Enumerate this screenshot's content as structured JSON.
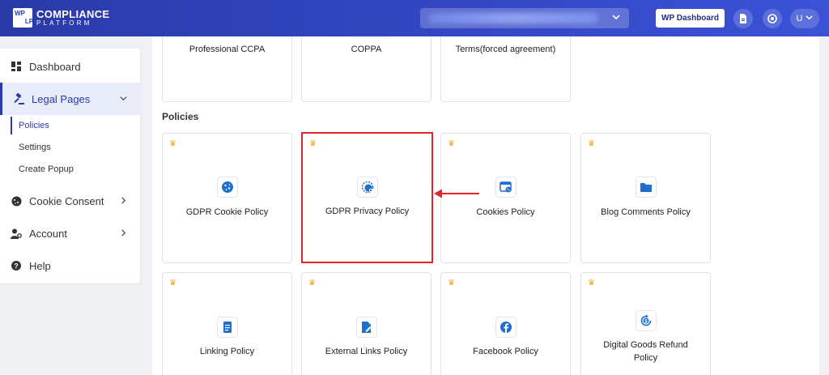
{
  "header": {
    "logo_box": [
      "WP",
      "LP"
    ],
    "logo_title": "COMPLIANCE",
    "logo_sub": "PLATFORM",
    "wp_dashboard": "WP Dashboard",
    "user_initial": "U",
    "brand_color": "#2a3aa8"
  },
  "sidebar": {
    "items": [
      {
        "label": "Dashboard",
        "icon": "grid-icon"
      },
      {
        "label": "Legal Pages",
        "icon": "gavel-icon"
      },
      {
        "label": "Cookie Consent",
        "icon": "cookie-icon"
      },
      {
        "label": "Account",
        "icon": "user-cog-icon"
      },
      {
        "label": "Help",
        "icon": "help-icon"
      }
    ],
    "sub": [
      "Policies",
      "Settings",
      "Create Popup"
    ]
  },
  "main": {
    "top_cards": [
      "Professional CCPA",
      "COPPA",
      "Terms(forced agreement)"
    ],
    "section_title": "Policies",
    "policies_row1": [
      {
        "title": "GDPR Cookie Policy",
        "icon": "cookie-icon"
      },
      {
        "title": "GDPR Privacy Policy",
        "icon": "privacy-icon"
      },
      {
        "title": "Cookies Policy",
        "icon": "browser-cookie-icon"
      },
      {
        "title": "Blog Comments Policy",
        "icon": "folder-icon"
      }
    ],
    "policies_row2": [
      {
        "title": "Linking Policy",
        "icon": "scroll-icon"
      },
      {
        "title": "External Links Policy",
        "icon": "edit-file-icon"
      },
      {
        "title": "Facebook Policy",
        "icon": "facebook-icon"
      },
      {
        "title": "Digital Goods Refund Policy",
        "icon": "refund-icon"
      }
    ],
    "accent_color": "#1e6fd0",
    "highlight_color": "#e0262a",
    "crown_color": "#e8a617"
  }
}
